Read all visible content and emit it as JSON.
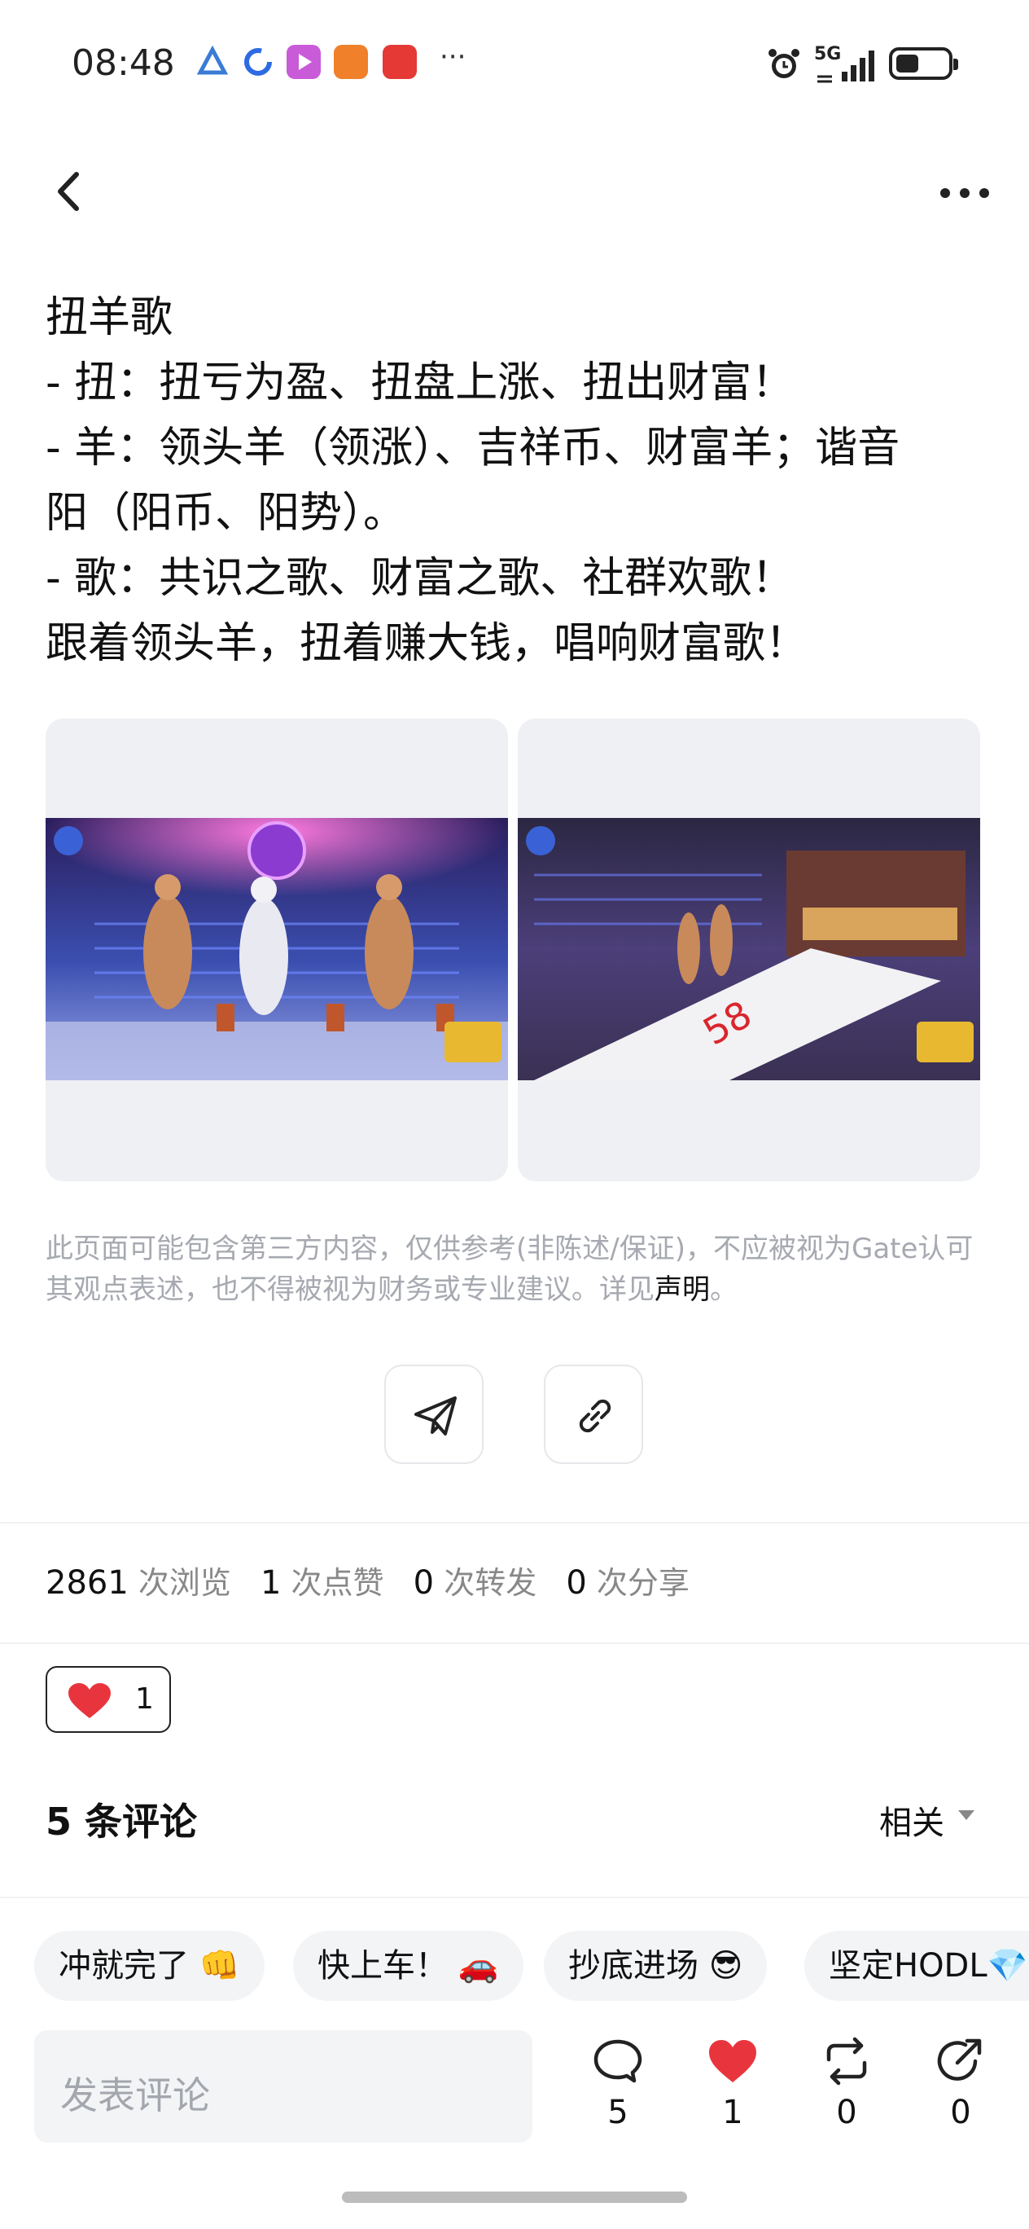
{
  "status_bar": {
    "time": "08:48",
    "network": "5G",
    "battery_level": 0.45,
    "app_icons": [
      "triangle-app-icon",
      "circle-app-icon",
      "video-app-icon",
      "shopping-app-icon",
      "news-app-icon"
    ],
    "overflow": "···"
  },
  "post": {
    "lines": [
      "扭羊歌",
      "- 扭：扭亏为盈、扭盘上涨、扭出财富！",
      "- 羊：领头羊（领涨）、吉祥币、财富羊；谐音",
      "阳（阳币、阳势）。",
      "- 歌：共识之歌、财富之歌、社群欢歌！",
      "跟着领头羊，扭着赚大钱，唱响财富歌！"
    ]
  },
  "images": [
    "stage-performance-photo-1",
    "stage-performance-photo-2"
  ],
  "disclaimer": {
    "text": "此页面可能包含第三方内容，仅供参考(非陈述/保证)，不应被视为Gate认可其观点表述，也不得被视为财务或专业建议。详见",
    "link": "声明",
    "end": "。"
  },
  "stats": {
    "views": "2861",
    "views_label": "次浏览",
    "likes": "1",
    "likes_label": "次点赞",
    "reposts": "0",
    "reposts_label": "次转发",
    "shares": "0",
    "shares_label": "次分享"
  },
  "reaction": {
    "count": "1"
  },
  "comments": {
    "title": "5 条评论",
    "sort": "相关"
  },
  "quick_replies": [
    "冲就完了 👊",
    "快上车！ 🚗",
    "抄底进场 😎",
    "坚定HODL💎"
  ],
  "bottom_bar": {
    "input_placeholder": "发表评论",
    "comment_count": "5",
    "like_count": "1",
    "repost_count": "0",
    "share_count": "0"
  },
  "colors": {
    "like_red": "#e8353d",
    "muted_text": "#a6a9b0",
    "chip_bg": "#f3f4f6"
  }
}
